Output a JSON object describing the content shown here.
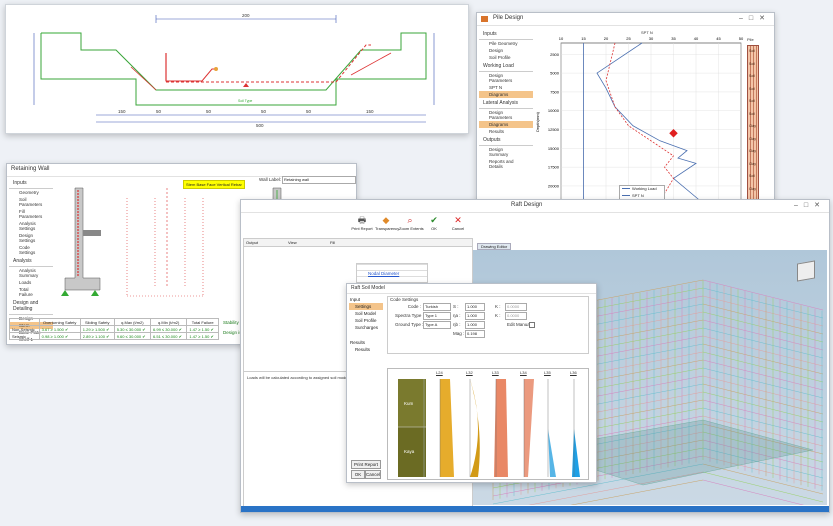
{
  "drawing": {
    "dims_top": "200",
    "dims_bottom": [
      "150",
      "50",
      "50",
      "50",
      "50",
      "150"
    ],
    "dims_total": "500",
    "label_mid": "Soil Type"
  },
  "pile": {
    "title": "Pile Design",
    "nav": [
      {
        "section": "Inputs",
        "items": [
          "Pile Geometry",
          "Design",
          "Soil Profile"
        ]
      },
      {
        "section": "Working Load",
        "items": [
          "Design Parameters",
          "SPT N",
          "Diagrams"
        ]
      },
      {
        "section": "Lateral Analysis",
        "items": [
          "Design Parameters",
          "Diagrams",
          "Results"
        ]
      },
      {
        "section": "Outputs",
        "items": [
          "Design Summary",
          "Reports and Details"
        ]
      }
    ],
    "selected_item": "Diagrams",
    "chart_top_label": "SPT N",
    "legend": [
      "Working Load",
      "SPT N"
    ],
    "soil_col_title": "Pile",
    "soil_labels": [
      "Soil",
      "Soil",
      "Soil",
      "Soil",
      "Soil",
      "Soil",
      "Clay",
      "Clay",
      "Clay",
      "Clay",
      "Soil",
      "Clay"
    ]
  },
  "chart_data": {
    "type": "line",
    "title": "",
    "x_ticks": [
      "10",
      "15",
      "20",
      "25",
      "30",
      "35",
      "40",
      "45",
      "50"
    ],
    "y_ticks": [
      "2500",
      "5000",
      "7500",
      "10000",
      "12500",
      "15000",
      "17500",
      "20000"
    ],
    "ylabel": "Depth(mm)",
    "xlim": [
      10,
      50
    ],
    "ylim": [
      1000,
      22000
    ],
    "series": [
      {
        "name": "Working Load",
        "x": [
          28,
          18,
          20,
          22,
          26,
          32,
          38,
          36,
          40,
          35,
          41
        ],
        "y": [
          1000,
          5000,
          7000,
          9500,
          12000,
          14000,
          15300,
          16300,
          17000,
          19000,
          22000
        ]
      },
      {
        "name": "SPT N",
        "x": [
          15,
          15
        ],
        "y": [
          1000,
          22000
        ]
      },
      {
        "name": "",
        "x": [
          22,
          20,
          22,
          25,
          30,
          35,
          33,
          35,
          32
        ],
        "y": [
          1000,
          6000,
          9500,
          12000,
          14000,
          16000,
          17500,
          19000,
          22000
        ]
      }
    ]
  },
  "wall": {
    "title": "Retaining Wall",
    "nav": [
      {
        "section": "Inputs",
        "items": [
          "Geometry",
          "Soil Parameters",
          "Fill Parameters",
          "Analysis Settings",
          "Design Settings",
          "Code Settings"
        ]
      },
      {
        "section": "Analysis",
        "items": [
          "Analysis Summary",
          "Loads",
          "Total Failure"
        ]
      },
      {
        "section": "Design and Detailing",
        "items": [
          "Design",
          "Stem",
          "Base Plate",
          "Shelf 1"
        ]
      },
      {
        "section": "Outputs",
        "items": [
          "Drawing & Report"
        ]
      }
    ],
    "selected_item": "Stem",
    "yellow_tag": "Stem Base Face Vertical Rebar",
    "wall_label": "Wall Label:",
    "wall_value": "Retaining wall",
    "status1": "Stability analyses are successful",
    "status2": "Design is successful",
    "table_headers": [
      "",
      "Overturning Safety",
      "Sliding Safety",
      "q.Max (t/m2)",
      "q.Min (t/m2)",
      "Total Failure"
    ],
    "table_rows": [
      [
        "Non-Seismic",
        "3.67 ≥ 1.500 ✔",
        "1.29 ≥ 1.500 ✔",
        "5.30 ≤ 30.000 ✔",
        "6.99 ≤ 30.000 ✔",
        "1.47 ≥ 1.50 ✔"
      ],
      [
        "Seismic",
        "0.98 ≥ 1.000 ✔",
        "2.89 ≥ 1.100 ✔",
        "9.60 ≤ 30.000 ✔",
        "6.51 ≤ 30.000 ✔",
        "1.47 ≥ 1.50 ✔"
      ]
    ],
    "btn_prepare": "Prepare Drawing",
    "btn_cancel": "Cancel"
  },
  "raft": {
    "title": "Raft Design",
    "toolbar": [
      "Print Report",
      "Transparency",
      "Zoom Extents",
      "OK",
      "Cancel"
    ],
    "panel_tabs": [
      "Output",
      "View",
      "Fill"
    ],
    "drawing_tab": "Drawing Editor",
    "link": "Nodal Diameter",
    "note": "Loads will be calculated according to assigned soil model",
    "btn_print": "Print Report",
    "btn_ok": "OK",
    "btn_cancel": "Cancel"
  },
  "soil": {
    "title": "Raft Soil Model",
    "nav_input": "Input",
    "nav_items": [
      "Settings",
      "Soil Model",
      "Soil Profile",
      "Surcharges"
    ],
    "nav_results": "Results",
    "nav_result_items": [
      "Results"
    ],
    "code_settings": "Code Settings",
    "fields": [
      {
        "label": "Code :",
        "value": "Turkish"
      },
      {
        "label": "Spectra Type :",
        "value": "Type 1"
      },
      {
        "label": "Ground Type :",
        "value": "Type A"
      }
    ],
    "params": [
      {
        "label": "S :",
        "value": "1.000"
      },
      {
        "label": "ηa :",
        "value": "1.000"
      },
      {
        "label": "ηb :",
        "value": "1.000"
      },
      {
        "label": "Mag :",
        "value": "0.198"
      }
    ],
    "params2": [
      {
        "label": "K :",
        "value": "0.0000"
      },
      {
        "label": "K :",
        "value": "0.0000"
      }
    ],
    "edit_manually": "Edit Manually",
    "diagram_titles": [
      "L24",
      "L32",
      "L33",
      "L34",
      "L35",
      "L36"
    ],
    "layer_labels": [
      "Kum",
      "Kaya"
    ],
    "btn_print": "Print Report",
    "btn_ok": "OK",
    "btn_cancel": "Cancel"
  }
}
